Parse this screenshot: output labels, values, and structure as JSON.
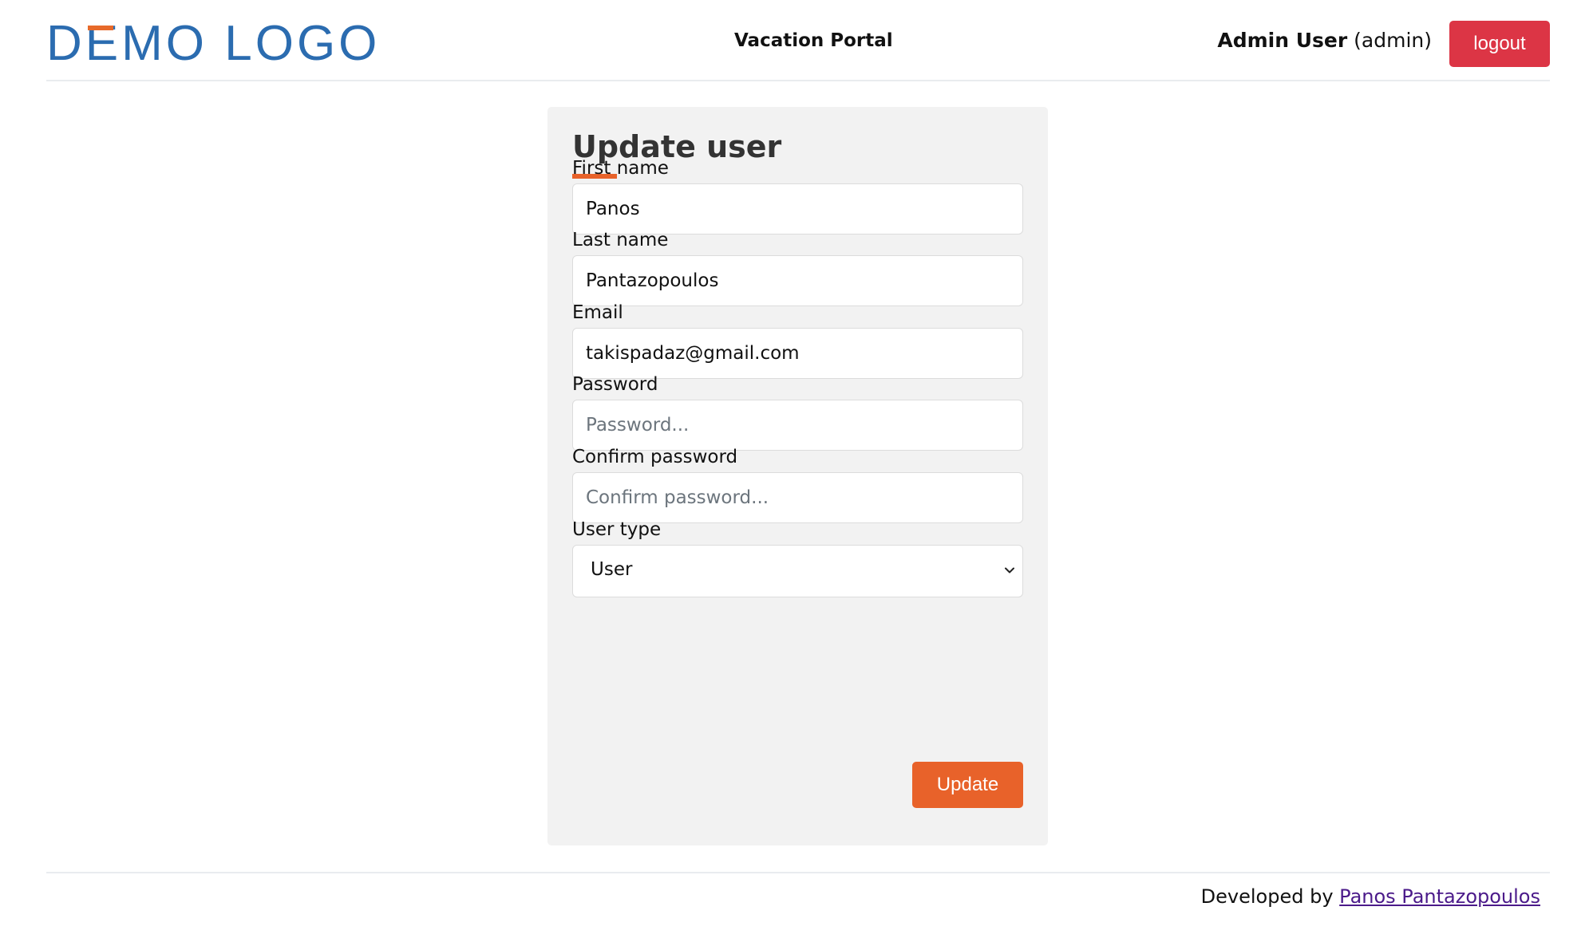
{
  "header": {
    "logo_parts": [
      "D",
      "E",
      "MO LOGO"
    ],
    "portal_title": "Vacation Portal",
    "user_name": "Admin User",
    "user_role": "(admin)",
    "logout_label": "logout"
  },
  "form": {
    "title": "Update user",
    "first_name": {
      "label": "First name",
      "value": "Panos",
      "placeholder": ""
    },
    "last_name": {
      "label": "Last name",
      "value": "Pantazopoulos",
      "placeholder": ""
    },
    "email": {
      "label": "Email",
      "value": "takispadaz@gmail.com",
      "placeholder": ""
    },
    "password": {
      "label": "Password",
      "value": "",
      "placeholder": "Password..."
    },
    "confirm_password": {
      "label": "Confirm password",
      "value": "",
      "placeholder": "Confirm password..."
    },
    "user_type": {
      "label": "User type",
      "selected": "User"
    },
    "submit_label": "Update"
  },
  "footer": {
    "prefix": "Developed by",
    "author": "Panos Pantazopoulos"
  },
  "colors": {
    "brand_blue": "#2b6cb0",
    "accent_orange": "#e8622a",
    "danger_red": "#dc3545",
    "card_bg": "#f2f2f2"
  }
}
